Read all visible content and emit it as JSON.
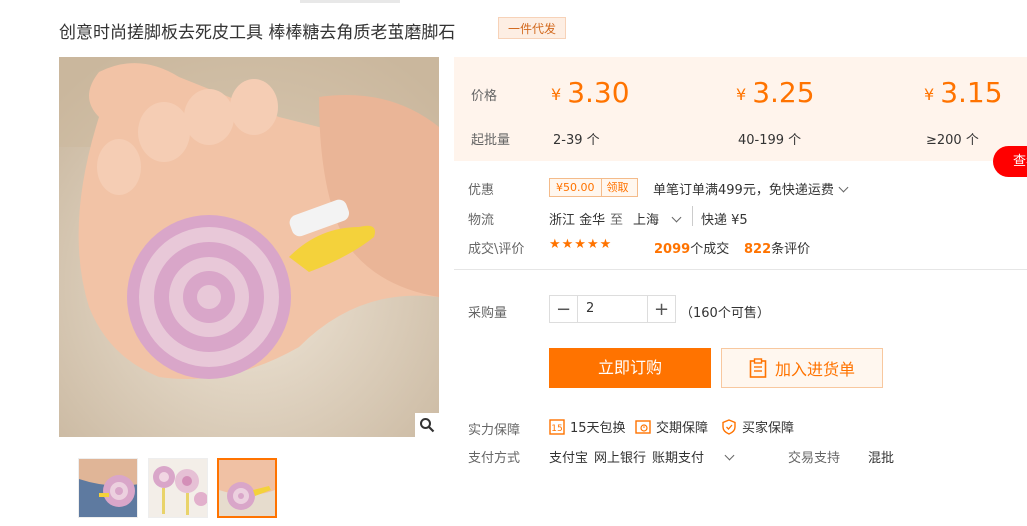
{
  "product": {
    "title": "创意时尚搓脚板去死皮工具 棒棒糖去角质老茧磨脚石",
    "tag": "一件代发"
  },
  "pricing": {
    "price_label": "价格",
    "moq_label": "起批量",
    "currency": "¥",
    "tiers": [
      {
        "price": "3.30",
        "range": "2-39 个"
      },
      {
        "price": "3.25",
        "range": "40-199 个"
      },
      {
        "price": "3.15",
        "range": "≥200 个"
      }
    ]
  },
  "side_button": {
    "label": "查看"
  },
  "promo": {
    "label": "优惠",
    "coupon_amount": "¥50.00",
    "coupon_action": "领取",
    "text": "单笔订单满499元，免快递运费"
  },
  "logistics": {
    "label": "物流",
    "from": "浙江 金华",
    "to_word": "至",
    "to": "上海",
    "method": "快递 ¥5"
  },
  "reviews": {
    "label": "成交\\评价",
    "stars": "★★★★★",
    "deals": "2099",
    "deals_suffix": "个成交",
    "reviews": "822",
    "reviews_suffix": "条评价"
  },
  "purchase": {
    "label": "采购量",
    "quantity": "2",
    "minus": "−",
    "plus": "+",
    "available": "（160个可售）",
    "buy_label": "立即订购",
    "cart_label": "加入进货单"
  },
  "guarantee": {
    "label": "实力保障",
    "items": [
      "15天包换",
      "交期保障",
      "买家保障"
    ]
  },
  "payment": {
    "label": "支付方式",
    "methods": [
      "支付宝",
      "网上银行",
      "账期支付"
    ],
    "trade_label": "交易支持",
    "trade_value": "混批"
  },
  "colors": {
    "accent": "#ff7300",
    "price_bg": "#fff4ec",
    "red": "#ff0000"
  }
}
